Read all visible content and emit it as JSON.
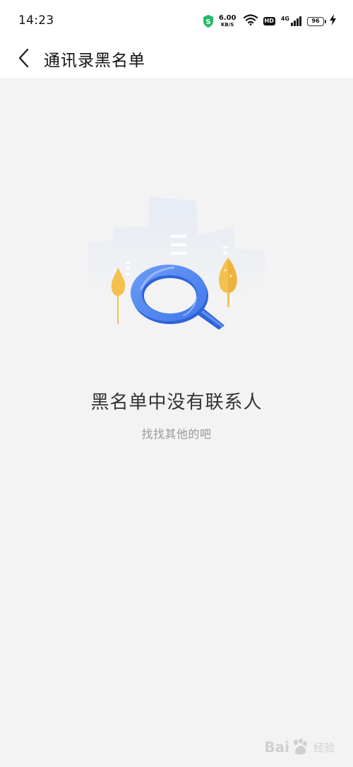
{
  "status_bar": {
    "time": "14:23",
    "net_speed_value": "6.00",
    "net_speed_unit": "KB/S",
    "hd_label": "HD",
    "signal_label": "4G",
    "battery_level": "96"
  },
  "app_bar": {
    "title": "通讯录黑名单"
  },
  "empty_state": {
    "title": "黑名单中没有联系人",
    "subtitle": "找找其他的吧"
  },
  "watermark": {
    "logo_text": "Bai",
    "cn_text": "经验"
  },
  "colors": {
    "accent_blue": "#4f86f0",
    "tree_yellow": "#f4c04e",
    "background": "#f3f3f3",
    "bar_background": "#ffffff"
  }
}
